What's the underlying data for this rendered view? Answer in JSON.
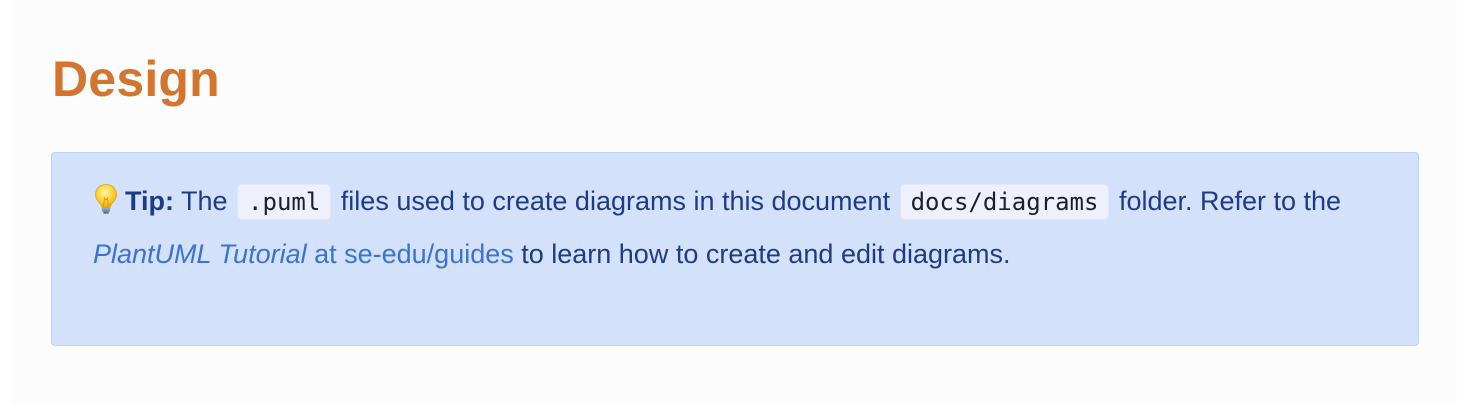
{
  "heading": "Design",
  "tip": {
    "icon": "lightbulb-icon",
    "label": "Tip:",
    "text_1": " The ",
    "code_1": ".puml",
    "text_2": " files used to create diagrams in this document ",
    "code_2": "docs/diagrams",
    "text_3": " folder. Refer to the ",
    "link_italic": "PlantUML Tutorial",
    "link_rest": " at se-edu/guides",
    "text_4": " to learn how to create and edit diagrams."
  },
  "colors": {
    "heading": "#d3752f",
    "tip_background": "#d3e1fa",
    "tip_border": "#bcd2f6",
    "tip_text": "#1f3b86",
    "link": "#3b73d0"
  }
}
